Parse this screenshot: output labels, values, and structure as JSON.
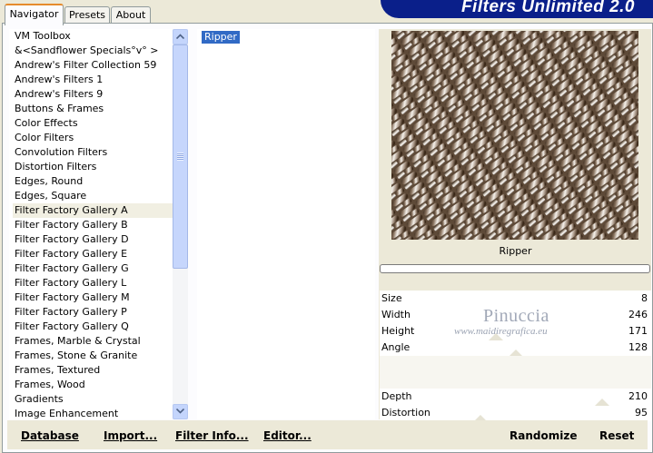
{
  "tabs": [
    {
      "label": "Navigator",
      "active": true
    },
    {
      "label": "Presets",
      "active": false
    },
    {
      "label": "About",
      "active": false
    }
  ],
  "brand": {
    "title": "Filters Unlimited 2.0"
  },
  "categories": [
    "VM Toolbox",
    "&<Sandflower Specials°v° >",
    "Andrew's Filter Collection 59",
    "Andrew's Filters 1",
    "Andrew's Filters 9",
    "Buttons & Frames",
    "Color Effects",
    "Color Filters",
    "Convolution Filters",
    "Distortion Filters",
    "Edges, Round",
    "Edges, Square",
    "Filter Factory Gallery A",
    "Filter Factory Gallery B",
    "Filter Factory Gallery D",
    "Filter Factory Gallery E",
    "Filter Factory Gallery G",
    "Filter Factory Gallery L",
    "Filter Factory Gallery M",
    "Filter Factory Gallery P",
    "Filter Factory Gallery Q",
    "Frames, Marble & Crystal",
    "Frames, Stone & Granite",
    "Frames, Textured",
    "Frames, Wood",
    "Gradients",
    "Image Enhancement"
  ],
  "selected_category_index": 12,
  "filters": [
    "Ripper"
  ],
  "preview": {
    "caption": "Ripper"
  },
  "params": [
    {
      "name": "Size",
      "value": "8"
    },
    {
      "name": "Width",
      "value": "246"
    },
    {
      "name": "Height",
      "value": "171"
    },
    {
      "name": "Angle",
      "value": "128"
    },
    {
      "name": "",
      "value": ""
    },
    {
      "name": "",
      "value": ""
    },
    {
      "name": "Depth",
      "value": "210"
    },
    {
      "name": "Distortion",
      "value": "95"
    }
  ],
  "watermark": {
    "name": "Pinuccia",
    "url": "www.maidiregrafica.eu"
  },
  "buttons": {
    "database": "Database",
    "import": "Import...",
    "filter_info": "Filter Info...",
    "editor": "Editor...",
    "randomize": "Randomize",
    "reset": "Reset"
  },
  "colors": {
    "brand_bg": "#0a1f8a",
    "selection": "#316ac5",
    "scrollbar": "#c6d6fc"
  }
}
